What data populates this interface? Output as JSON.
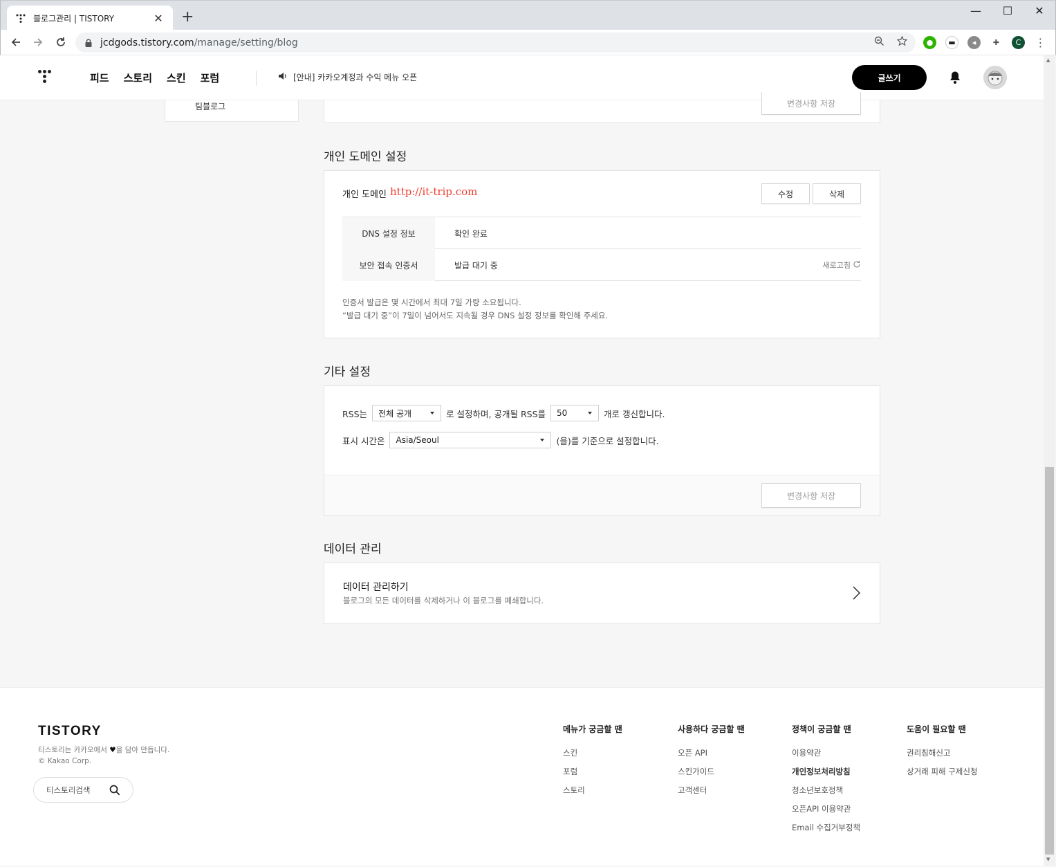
{
  "browser": {
    "tab_title": "블로그관리 | TISTORY",
    "url_host": "jcdgods.tistory.com",
    "url_path": "/manage/setting/blog",
    "profile_initial": "C"
  },
  "header": {
    "nav": [
      "피드",
      "스토리",
      "스킨",
      "포럼"
    ],
    "notice": "[안내] 카카오계정과 수익 메뉴 오픈",
    "write_label": "글쓰기"
  },
  "sidenav": {
    "item": "팀블로그"
  },
  "prev_section": {
    "save_label": "변경사항 저장"
  },
  "domain": {
    "title": "개인 도메인 설정",
    "label": "개인 도메인",
    "url": "http://it-trip.com",
    "edit_label": "수정",
    "delete_label": "삭제",
    "rows": [
      {
        "key": "DNS 설정 정보",
        "value": "확인 완료"
      },
      {
        "key": "보안 접속 인증서",
        "value": "발급 대기 중"
      }
    ],
    "refresh_label": "새로고침",
    "note_line1": "인증서 발급은 몇 시간에서 최대 7일 가량 소요됩니다.",
    "note_line2": "“발급 대기 중”이 7일이 넘어서도 지속될 경우 DNS 설정 정보를 확인해 주세요."
  },
  "etc": {
    "title": "기타 설정",
    "rss_prefix": "RSS는",
    "rss_visibility": "전체 공개",
    "rss_middle": "로 설정하며, 공개될 RSS를",
    "rss_count": "50",
    "rss_suffix": "개로 갱신합니다.",
    "time_prefix": "표시 시간은",
    "timezone": "Asia/Seoul",
    "time_suffix": "(을)를 기준으로 설정합니다.",
    "save_label": "변경사항 저장"
  },
  "data_mgmt": {
    "title": "데이터 관리",
    "item_title": "데이터 관리하기",
    "item_desc": "블로그의 모든 데이터를 삭제하거나 이 블로그를 폐쇄합니다."
  },
  "footer": {
    "logo": "TISTORY",
    "desc_before": "티스토리는 카카오에서",
    "desc_after": "을 담아 만듭니다.",
    "copyright": "© Kakao Corp.",
    "search_placeholder": "티스토리검색",
    "columns": [
      {
        "title": "메뉴가 궁금할 땐",
        "links": [
          "스킨",
          "포럼",
          "스토리"
        ]
      },
      {
        "title": "사용하다 궁금할 땐",
        "links": [
          "오픈 API",
          "스킨가이드",
          "고객센터"
        ]
      },
      {
        "title": "정책이 궁금할 땐",
        "links": [
          "이용약관",
          "개인정보처리방침",
          "청소년보호정책",
          "오픈API 이용약관",
          "Email 수집거부정책"
        ]
      },
      {
        "title": "도움이 필요할 땐",
        "links": [
          "권리침해신고",
          "상거래 피해 구제신청"
        ]
      }
    ]
  },
  "colors": {
    "accent_red": "#f03e2f",
    "black": "#000000",
    "bg": "#f6f6f6"
  }
}
